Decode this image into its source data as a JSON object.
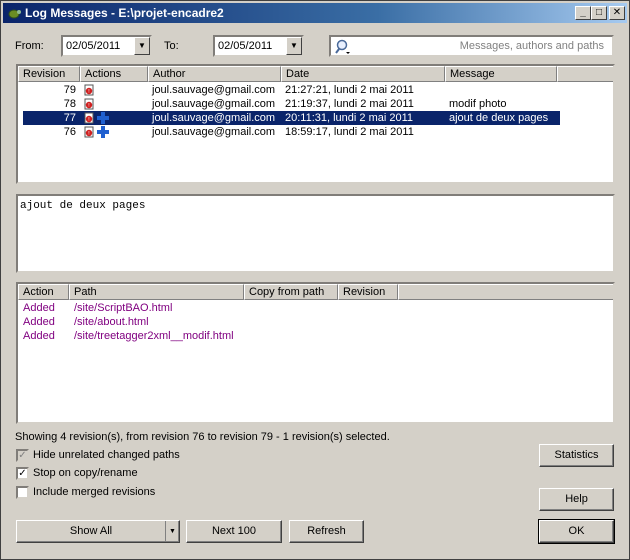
{
  "window": {
    "title": "Log Messages - E:\\projet-encadre2"
  },
  "filters": {
    "from_label": "From:",
    "from_value": "02/05/2011",
    "to_label": "To:",
    "to_value": "02/05/2011",
    "search_placeholder": "Messages, authors and paths"
  },
  "revisions": {
    "headers": [
      "Revision",
      "Actions",
      "Author",
      "Date",
      "Message"
    ],
    "rows": [
      {
        "revision": "79",
        "author": "joul.sauvage@gmail.com",
        "date": "21:27:21, lundi 2 mai 2011",
        "message": "",
        "actions": [
          "modified"
        ]
      },
      {
        "revision": "78",
        "author": "joul.sauvage@gmail.com",
        "date": "21:19:37, lundi 2 mai 2011",
        "message": "modif photo",
        "actions": [
          "modified"
        ]
      },
      {
        "revision": "77",
        "author": "joul.sauvage@gmail.com",
        "date": "20:11:31, lundi 2 mai 2011",
        "message": "ajout de deux pages",
        "actions": [
          "modified",
          "added"
        ],
        "selected": true
      },
      {
        "revision": "76",
        "author": "joul.sauvage@gmail.com",
        "date": "18:59:17, lundi 2 mai 2011",
        "message": "",
        "actions": [
          "modified",
          "added"
        ]
      }
    ]
  },
  "message_text": "ajout de deux pages",
  "paths": {
    "headers": [
      "Action",
      "Path",
      "Copy from path",
      "Revision"
    ],
    "rows": [
      {
        "action": "Added",
        "path": "/site/ScriptBAO.html"
      },
      {
        "action": "Added",
        "path": "/site/about.html"
      },
      {
        "action": "Added",
        "path": "/site/treetagger2xml__modif.html"
      }
    ]
  },
  "status_text": "Showing 4 revision(s), from revision 76 to revision 79 - 1 revision(s) selected.",
  "options": {
    "hide_unrelated": {
      "label": "Hide unrelated changed paths",
      "checked": true,
      "enabled": false
    },
    "stop_on_copy": {
      "label": "Stop on copy/rename",
      "checked": true,
      "enabled": true
    },
    "include_merged": {
      "label": "Include merged revisions",
      "checked": false,
      "enabled": true
    }
  },
  "buttons": {
    "statistics": "Statistics",
    "help": "Help",
    "show_all": "Show All",
    "next100": "Next 100",
    "refresh": "Refresh",
    "ok": "OK"
  },
  "colors": {
    "titlebar_start": "#0a246a",
    "selection": "#0a246a",
    "added_text": "#800080",
    "dialog_bg": "#d4d0c8"
  }
}
